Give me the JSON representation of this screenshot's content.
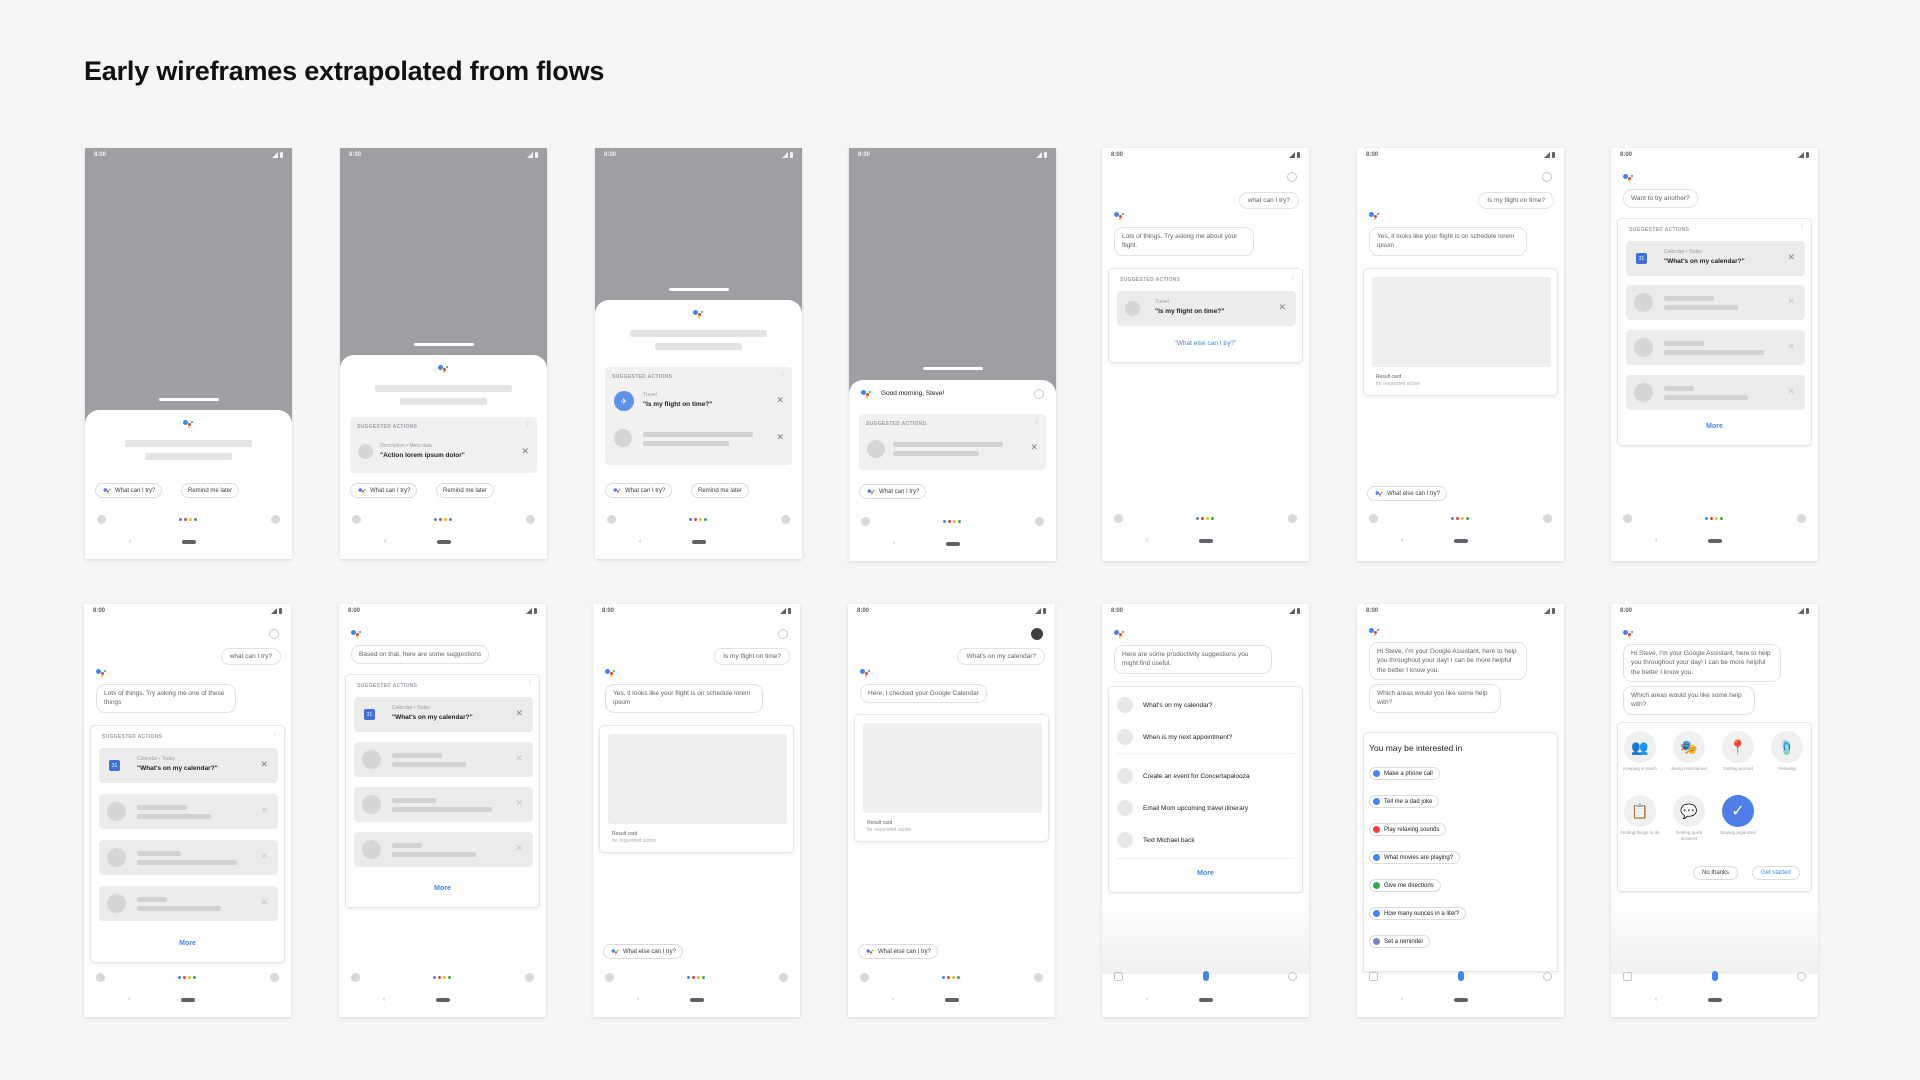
{
  "title": "Early wireframes extrapolated from flows",
  "status_time": "8:00",
  "chips": {
    "what_can_i_try": "What can I try?",
    "remind_me_later": "Remind me later",
    "what_else": "What else can I try?"
  },
  "suggested_actions_label": "SUGGESTED ACTIONS",
  "more_label": "More",
  "kebab": "⋮",
  "close": "✕",
  "phone2": {
    "meta": "Description  •  Meta data",
    "title": "\"Action lorem ipsum dolor\""
  },
  "phone3": {
    "meta": "Travel",
    "title": "\"Is my flight on time?\""
  },
  "phone4": {
    "greeting": "Good morning, Steve!"
  },
  "phone5": {
    "user": "what can I try?",
    "assistant": "Lots of things. Try asking me about your flight.",
    "meta": "Travel",
    "title": "\"Is my flight on time?\"",
    "link": "\"What else can I try?\""
  },
  "phone6": {
    "user": "Is my flight on time?",
    "assistant": "Yes, it looks like your flight is on schedule lorem ipsum",
    "result_label": "Result card",
    "result_sub": "for requested action"
  },
  "phone7": {
    "assistant": "Want to try another?",
    "meta": "Calendar  •  Today",
    "title": "\"What's on my calendar?\""
  },
  "phone8": {
    "user": "what can I try?",
    "assistant": "Lots of things. Try asking me one of these things",
    "meta": "Calendar  •  Today",
    "title": "\"What's on my calendar?\""
  },
  "phone9": {
    "assistant": "Based on that, here are some suggestions",
    "meta": "Calendar  •  Today",
    "title": "\"What's on my calendar?\""
  },
  "phone10": {
    "user": "Is my flight on time?",
    "assistant": "Yes, it looks like your flight is on schedule lorem ipsum",
    "result_label": "Result card",
    "result_sub": "for requested action"
  },
  "phone11": {
    "user": "What's on my calendar?",
    "assistant": "Here, I checked your Google Calendar",
    "result_label": "Result card",
    "result_sub": "for requested action"
  },
  "phone12": {
    "assistant": "Here are some productivity suggestions you might find useful.",
    "items": [
      "What's on my calendar?",
      "When is my next appointment?",
      "Create an event for Concertapalooza",
      "Email Mom upcoming travel itinerary",
      "Text Michael back"
    ]
  },
  "phone13": {
    "assistant1": "Hi Steve, I'm your Google Assistant, here to help you throughout your day! I can be more helpful the better I know you.",
    "assistant2": "Which areas would you like some help with?",
    "heading": "You may be interested in",
    "chips": [
      "Make a phone call",
      "Tell me a dad joke",
      "Play relaxing sounds",
      "What movies are playing?",
      "Give me directions",
      "How many ounces in a liter?",
      "Set a reminder"
    ],
    "chip_colors": [
      "#4285f4",
      "#4285f4",
      "#ea4335",
      "#4285f4",
      "#34a853",
      "#4285f4",
      "#7986cb"
    ]
  },
  "phone14": {
    "assistant1": "Hi Steve, I'm your Google Assistant, here to help you throughout your day! I can be more helpful the better I know you.",
    "assistant2": "Which areas would you like some help with?",
    "areas": [
      {
        "label": "Keeping in touch",
        "icon": "👥"
      },
      {
        "label": "Being entertained",
        "icon": "🎭"
      },
      {
        "label": "Getting around",
        "icon": "📍"
      },
      {
        "label": "Relaxing",
        "icon": "🩴"
      },
      {
        "label": "Finding things to do",
        "icon": "📋"
      },
      {
        "label": "Getting quick answers",
        "icon": "💬"
      },
      {
        "label": "Staying organized",
        "icon": "✓"
      }
    ],
    "no_thanks": "No thanks",
    "get_started": "Get started"
  },
  "colors": {
    "google_blue": "#4285f4",
    "google_red": "#ea4335",
    "google_yellow": "#fbbc05",
    "google_green": "#34a853",
    "wire_gray": "#9e9fa3"
  }
}
